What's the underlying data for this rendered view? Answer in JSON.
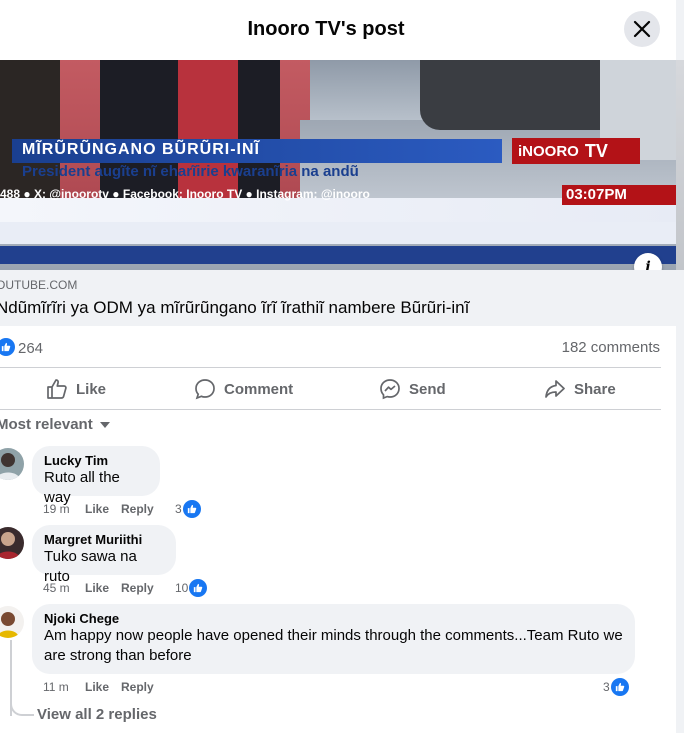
{
  "header": {
    "title": "Inooro TV's post"
  },
  "video": {
    "headline": "MĨRŨRŨNGANO BŨRŨRI-INĨ",
    "brand": "iNOORO",
    "brand_tv": "TV",
    "subline": "President augĩte nĩ eharĩirie kwaranĩria na andũ",
    "ticker": "488 ● X: @inoorotv ● Facebook: Inooro TV ● Instagram: @inooro",
    "time": "03:07PM"
  },
  "link": {
    "domain": "OUTUBE.COM",
    "title": "Ndũmĩrĩri ya ODM ya mĩrũrũngano ĩrĩ ĩrathiĩ nambere Bũrũri-inĩ"
  },
  "stats": {
    "likes": "264",
    "comments": "182 comments"
  },
  "actions": {
    "like": "Like",
    "comment": "Comment",
    "send": "Send",
    "share": "Share"
  },
  "sort": {
    "label": "Most relevant"
  },
  "comments": [
    {
      "name": "Lucky Tim",
      "text": "Ruto all the way",
      "time": "19 m",
      "like": "Like",
      "reply": "Reply",
      "reactions": "3"
    },
    {
      "name": "Margret Muriithi",
      "text": "Tuko sawa na ruto",
      "time": "45 m",
      "like": "Like",
      "reply": "Reply",
      "reactions": "10"
    },
    {
      "name": "Njoki Chege",
      "text_line1": "Am happy now people have opened their minds through the comments...Team Ruto we",
      "text_line2": "are strong than before",
      "time": "11 m",
      "like": "Like",
      "reply": "Reply",
      "reactions": "3"
    }
  ],
  "view_replies": "View all 2 replies",
  "colors": {
    "accent": "#1877f2",
    "secondary_text": "#65676b",
    "bubble": "#f0f2f5"
  }
}
